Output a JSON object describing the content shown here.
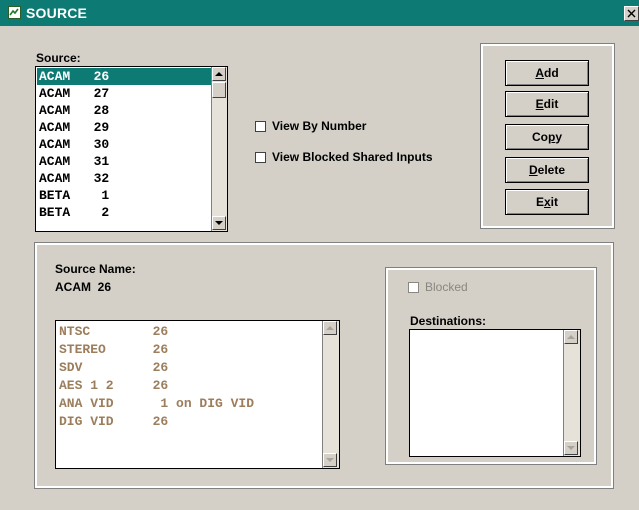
{
  "window": {
    "title": "SOURCE"
  },
  "source_list": {
    "label": "Source:",
    "items": [
      {
        "text": "ACAM   26",
        "selected": true
      },
      {
        "text": "ACAM   27"
      },
      {
        "text": "ACAM   28"
      },
      {
        "text": "ACAM   29"
      },
      {
        "text": "ACAM   30"
      },
      {
        "text": "ACAM   31"
      },
      {
        "text": "ACAM   32"
      },
      {
        "text": "BETA    1"
      },
      {
        "text": "BETA    2"
      }
    ]
  },
  "options": {
    "view_by_number": "View By Number",
    "view_blocked_shared_inputs": "View Blocked Shared Inputs"
  },
  "actions": {
    "add": {
      "pre": "",
      "key": "A",
      "post": "dd"
    },
    "edit": {
      "pre": "",
      "key": "E",
      "post": "dit"
    },
    "copy": {
      "pre": "Co",
      "key": "p",
      "post": "y"
    },
    "delete": {
      "pre": "",
      "key": "D",
      "post": "elete"
    },
    "exit": {
      "pre": "E",
      "key": "x",
      "post": "it"
    }
  },
  "detail": {
    "source_name_label": "Source Name:",
    "source_name_value": "ACAM  26",
    "signals": [
      "NTSC        26",
      "STEREO      26",
      "SDV         26",
      "AES 1 2     26",
      "ANA VID      1 on DIG VID",
      "DIG VID     26"
    ],
    "blocked_label": "Blocked",
    "destinations_label": "Destinations:",
    "destinations": []
  },
  "colors": {
    "titlebar": "#0e7a74",
    "selection": "#0e7a74",
    "dialog": "#d4d0c8",
    "signal_text": "#9c7e5c",
    "disabled_text": "#8a8680"
  }
}
